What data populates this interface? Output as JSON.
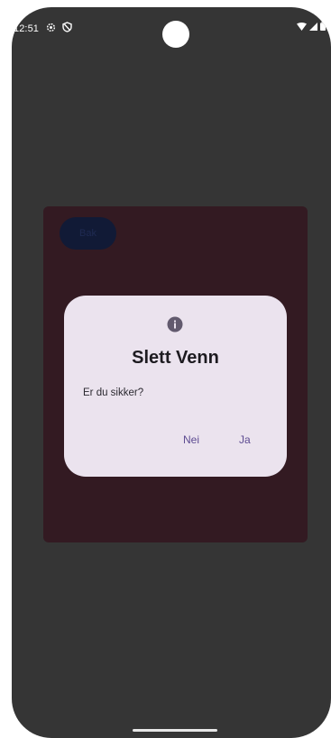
{
  "status_bar": {
    "time": "12:51",
    "left_icons": [
      "settings-gear-icon",
      "shield-icon"
    ],
    "right_icons": [
      "wifi-icon",
      "signal-icon",
      "battery-icon"
    ]
  },
  "app": {
    "back_label": "Bak"
  },
  "dialog": {
    "icon": "info-icon",
    "title": "Slett Venn",
    "message": "Er du sikker?",
    "dismiss_label": "Nei",
    "confirm_label": "Ja"
  },
  "colors": {
    "screen_background": "#353535",
    "app_panel": "#331a22",
    "dialog_surface": "#ebe3ee",
    "accent": "#5d4b91"
  }
}
